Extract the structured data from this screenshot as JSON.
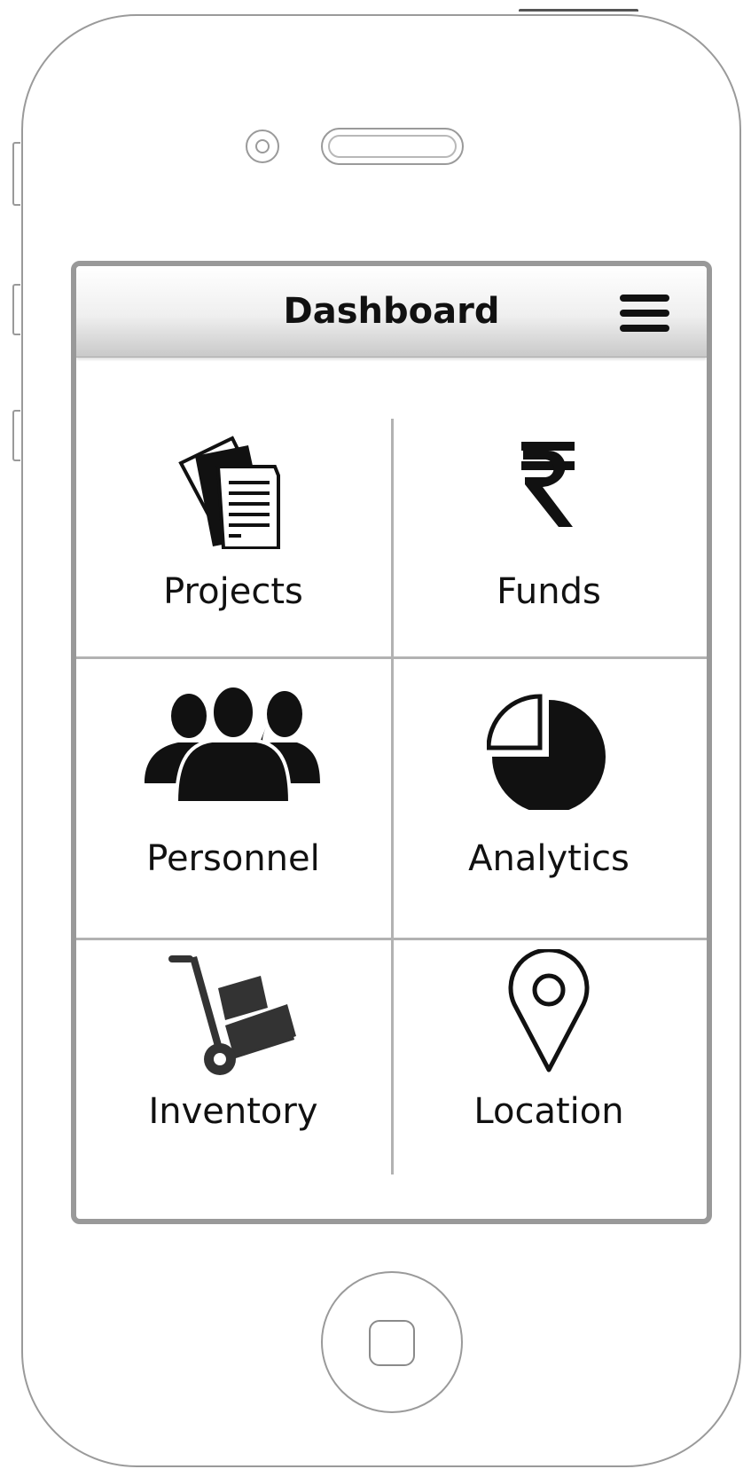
{
  "header": {
    "title": "Dashboard",
    "menu_icon": "hamburger-menu-icon"
  },
  "tiles": [
    {
      "id": "projects",
      "label": "Projects",
      "icon": "documents-icon"
    },
    {
      "id": "funds",
      "label": "Funds",
      "icon": "rupee-icon"
    },
    {
      "id": "personnel",
      "label": "Personnel",
      "icon": "people-group-icon"
    },
    {
      "id": "analytics",
      "label": "Analytics",
      "icon": "pie-chart-icon"
    },
    {
      "id": "inventory",
      "label": "Inventory",
      "icon": "hand-truck-icon"
    },
    {
      "id": "location",
      "label": "Location",
      "icon": "map-pin-icon"
    }
  ],
  "colors": {
    "icon": "#111111",
    "divider": "#b2b2b2",
    "frame": "#999999"
  }
}
